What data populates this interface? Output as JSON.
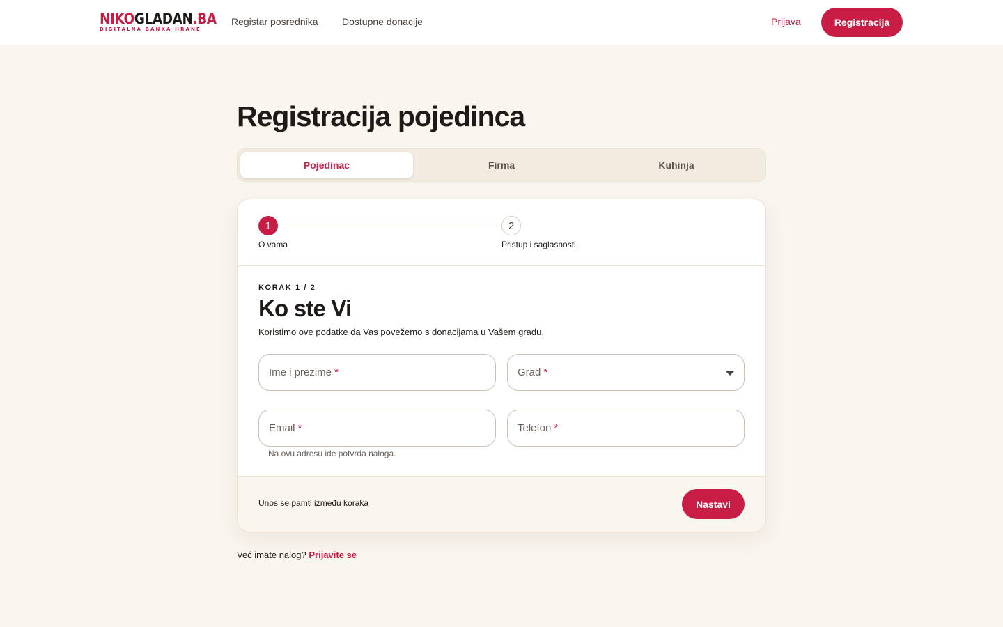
{
  "header": {
    "logo": {
      "part_red": "NIKO",
      "part_dark": "GLADAN",
      "suffix": ".BA",
      "tagline": "DIGITALNA BANKA HRANE"
    },
    "nav": [
      "Registar posrednika",
      "Dostupne donacije"
    ],
    "login_label": "Prijava",
    "register_label": "Registracija"
  },
  "page_title": "Registracija pojedinca",
  "tabs": [
    {
      "label": "Pojedinac",
      "active": true
    },
    {
      "label": "Firma",
      "active": false
    },
    {
      "label": "Kuhinja",
      "active": false
    }
  ],
  "stepper": {
    "steps": [
      {
        "number": "1",
        "label": "O vama",
        "active": true
      },
      {
        "number": "2",
        "label": "Pristup i saglasnosti",
        "active": false
      }
    ]
  },
  "form": {
    "step_counter": "KORAK 1 / 2",
    "title": "Ko ste Vi",
    "description": "Koristimo ove podatke da Vas povežemo s donacijama u Vašem gradu.",
    "required_mark": "*",
    "fields": {
      "name": {
        "label": "Ime i prezime"
      },
      "city": {
        "label": "Grad"
      },
      "email": {
        "label": "Email",
        "helper": "Na ovu adresu ide potvrda naloga."
      },
      "phone": {
        "label": "Telefon"
      }
    },
    "footer_note": "Unos se pamti između koraka",
    "next_label": "Nastavi"
  },
  "bottom": {
    "prompt": "Već imate nalog?",
    "link": "Prijavite se"
  },
  "colors": {
    "accent": "#c81d45",
    "background": "#f9f5ef",
    "text": "#1f1a17"
  }
}
